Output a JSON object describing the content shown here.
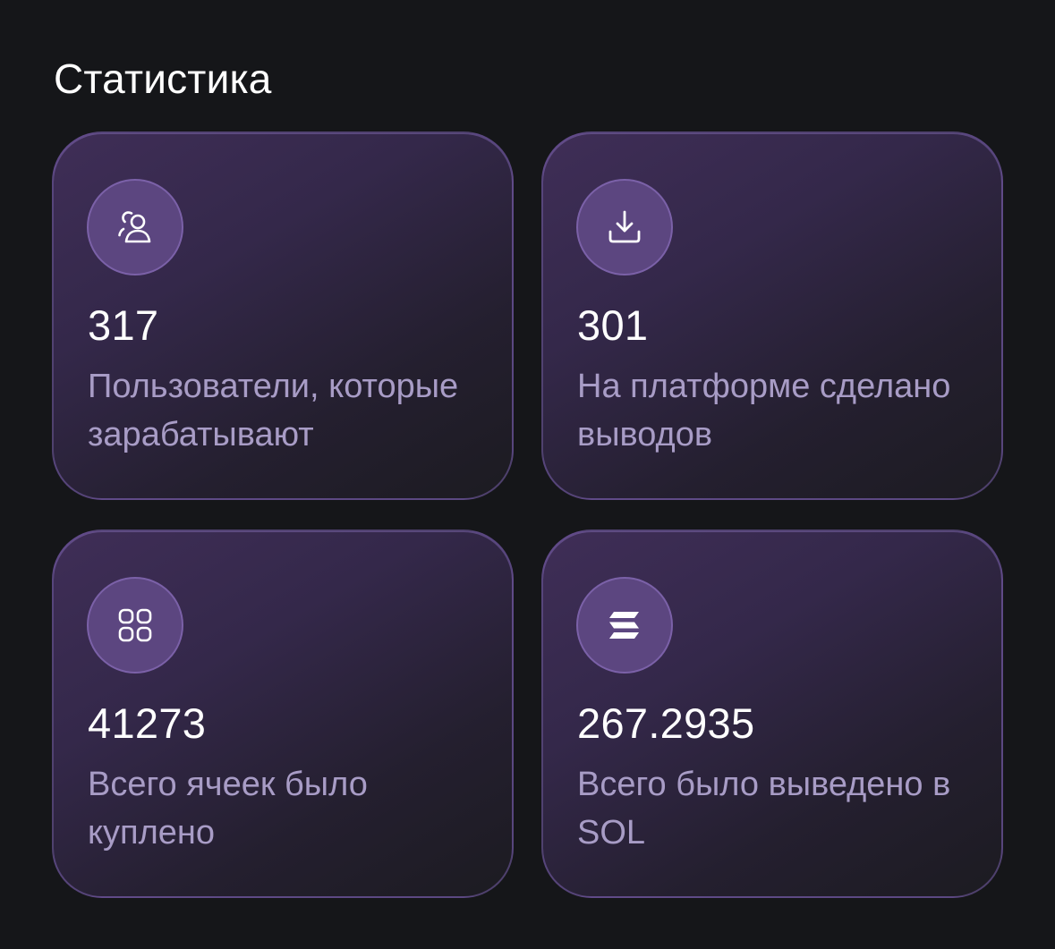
{
  "page": {
    "title": "Статистика"
  },
  "stats": [
    {
      "icon": "users-icon",
      "value": "317",
      "label": "Пользователи, которые зарабатывают"
    },
    {
      "icon": "download-icon",
      "value": "301",
      "label": "На платформе сделано выводов"
    },
    {
      "icon": "grid-icon",
      "value": "41273",
      "label": "Всего ячеек было куплено"
    },
    {
      "icon": "solana-icon",
      "value": "267.2935",
      "label": "Всего было выведено в SOL"
    }
  ],
  "colors": {
    "background": "#151619",
    "accent": "#5c4680",
    "label": "#a89cc6",
    "value": "#ffffff"
  }
}
